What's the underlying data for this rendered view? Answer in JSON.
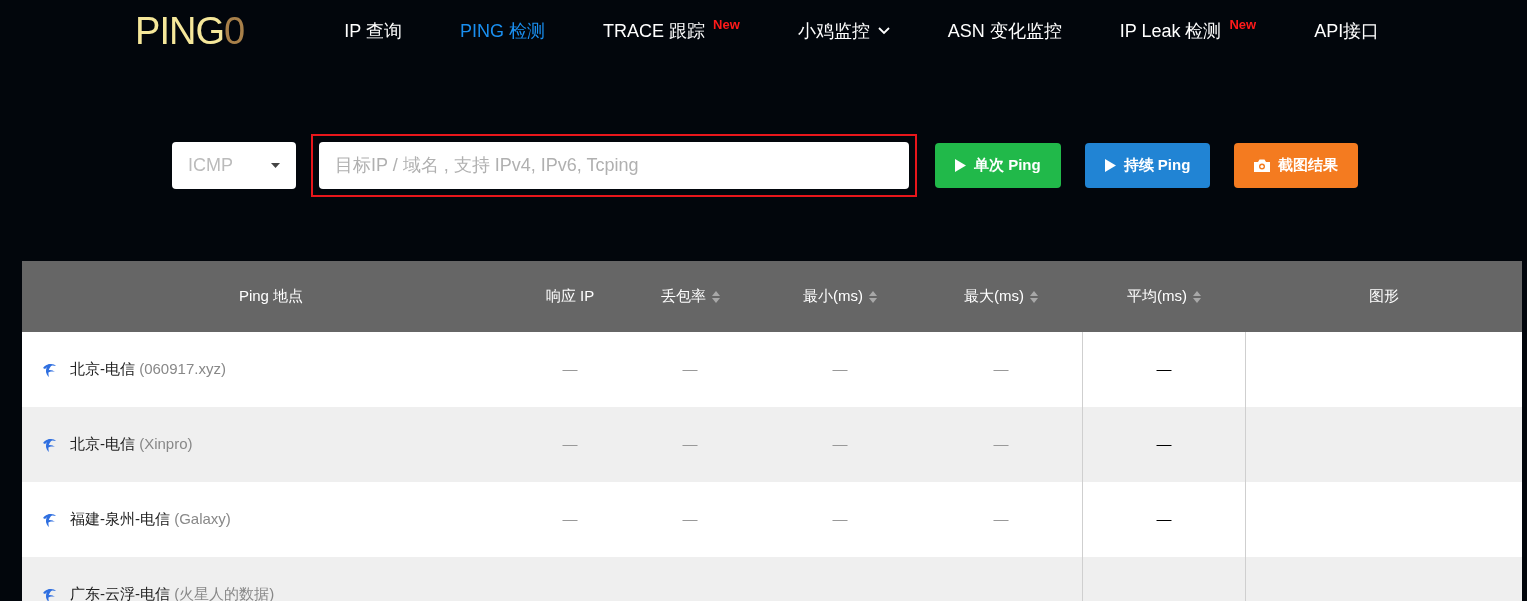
{
  "logo": {
    "text": "PING",
    "suffix": "0"
  },
  "nav": [
    {
      "label": "IP 查询",
      "selected": false
    },
    {
      "label": "PING 检测",
      "selected": true
    },
    {
      "label": "TRACE 跟踪",
      "selected": false,
      "badge": "New"
    },
    {
      "label": "小鸡监控",
      "selected": false,
      "dropdown": true
    },
    {
      "label": "ASN 变化监控",
      "selected": false
    },
    {
      "label": "IP Leak 检测",
      "selected": false,
      "badge": "New"
    },
    {
      "label": "API接口",
      "selected": false
    }
  ],
  "form": {
    "protocol": "ICMP",
    "target": {
      "placeholder": "目标IP / 域名 , 支持 IPv4, IPv6, Tcping",
      "highlighted": true
    },
    "buttons": [
      {
        "label": "单次 Ping",
        "kind": "play",
        "color": "#21b94a"
      },
      {
        "label": "持续 Ping",
        "kind": "play",
        "color": "#2184d4"
      },
      {
        "label": "截图结果",
        "kind": "camera",
        "color": "#f47b20"
      }
    ]
  },
  "table": {
    "columns": [
      {
        "label": "Ping 地点",
        "sortable": false
      },
      {
        "label": "响应 IP",
        "sortable": false
      },
      {
        "label": "丢包率",
        "sortable": true
      },
      {
        "label": "最小(ms)",
        "sortable": true
      },
      {
        "label": "最大(ms)",
        "sortable": true
      },
      {
        "label": "平均(ms)",
        "sortable": true
      },
      {
        "label": "图形",
        "sortable": false
      }
    ],
    "rows": [
      {
        "location": "北京-电信",
        "node": "(060917.xyz)",
        "values": [
          "—",
          "—",
          "—",
          "—",
          "—"
        ]
      },
      {
        "location": "北京-电信",
        "node": "(Xinpro)",
        "values": [
          "—",
          "—",
          "—",
          "—",
          "—"
        ]
      },
      {
        "location": "福建-泉州-电信",
        "node": "(Galaxy)",
        "values": [
          "—",
          "—",
          "—",
          "—",
          "—"
        ]
      },
      {
        "location": "广东-云浮-电信",
        "node": "(火星人的数据)"
      }
    ]
  }
}
